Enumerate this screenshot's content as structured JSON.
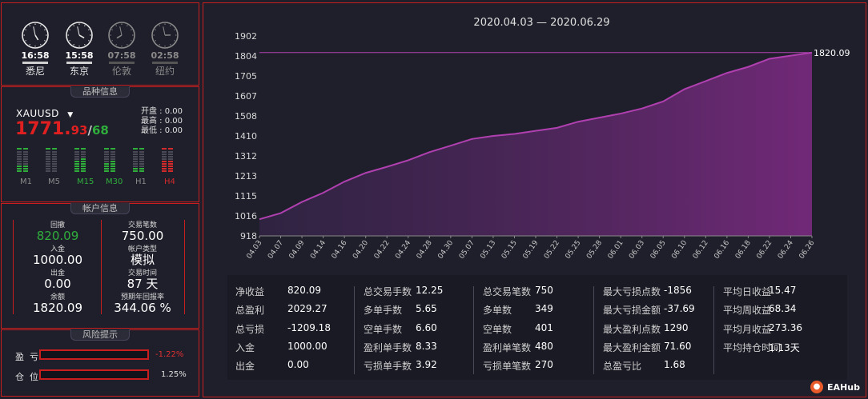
{
  "clocks": [
    {
      "time": "16:58",
      "city": "悉尼",
      "active": true,
      "h": 4,
      "m": 58
    },
    {
      "time": "15:58",
      "city": "东京",
      "active": true,
      "h": 3,
      "m": 58
    },
    {
      "time": "07:58",
      "city": "伦敦",
      "active": false,
      "h": 7,
      "m": 58
    },
    {
      "time": "02:58",
      "city": "纽约",
      "active": false,
      "h": 2,
      "m": 58
    }
  ],
  "symbol_panel": {
    "title": "品种信息",
    "symbol": "XAUUSD",
    "price_main": "1771.",
    "price_small": "93",
    "price_sep": "/",
    "price_ask": "68",
    "open": "开盘 : 0.00",
    "high": "最高 : 0.00",
    "low": "最低 : 0.00",
    "timeframes": [
      {
        "label": "M1",
        "color": "#8a8a8a"
      },
      {
        "label": "M5",
        "color": "#8a8a8a"
      },
      {
        "label": "M15",
        "color": "#2fae3c"
      },
      {
        "label": "M30",
        "color": "#2fae3c"
      },
      {
        "label": "H1",
        "color": "#8a8a8a"
      },
      {
        "label": "H4",
        "color": "#d22a2a"
      }
    ]
  },
  "account_panel": {
    "title": "帐户信息",
    "drawdown_label": "回撤",
    "drawdown_value": "820.09",
    "trades_label": "交易笔数",
    "trades_value": "750.00",
    "deposit_label": "入金",
    "deposit_value": "1000.00",
    "acct_type_label": "帐户类型",
    "acct_type_value": "模拟",
    "withdraw_label": "出金",
    "withdraw_value": "0.00",
    "trade_time_label": "交易时间",
    "trade_time_value": "87 天",
    "balance_label": "余额",
    "balance_value": "1820.09",
    "annual_label": "预期年回报率",
    "annual_value": "344.06 %"
  },
  "risk_panel": {
    "title": "风险提示",
    "pl_label": "盈  亏",
    "pl_value": "-1.22%",
    "pl_color": "#e03030",
    "pos_label": "仓  位",
    "pos_value": "1.25%"
  },
  "chart_data": {
    "type": "area",
    "title": "2020.04.03 — 2020.06.29",
    "x": [
      "04.03",
      "04.07",
      "04.09",
      "04.14",
      "04.16",
      "04.20",
      "04.22",
      "04.24",
      "04.28",
      "04.30",
      "05.07",
      "05.13",
      "05.15",
      "05.19",
      "05.22",
      "05.25",
      "05.28",
      "06.01",
      "06.03",
      "06.05",
      "06.10",
      "06.12",
      "06.16",
      "06.18",
      "06.22",
      "06.24",
      "06.26"
    ],
    "y": [
      1000,
      1030,
      1085,
      1130,
      1185,
      1228,
      1258,
      1290,
      1330,
      1362,
      1395,
      1410,
      1420,
      1435,
      1450,
      1480,
      1500,
      1520,
      1545,
      1580,
      1640,
      1680,
      1720,
      1750,
      1790,
      1805,
      1820.09
    ],
    "ylim": [
      918,
      1902
    ],
    "yticks": [
      1902,
      1804,
      1705,
      1607,
      1508,
      1410,
      1312,
      1213,
      1115,
      1016,
      918
    ],
    "last_label": "1820.09",
    "color": "#b040b0"
  },
  "stats": [
    {
      "k": "净收益",
      "v": "820.09"
    },
    {
      "k": "总盈利",
      "v": "2029.27"
    },
    {
      "k": "总亏损",
      "v": "-1209.18"
    },
    {
      "k": "入金",
      "v": "1000.00"
    },
    {
      "k": "出金",
      "v": "0.00"
    },
    {
      "k": "总交易手数",
      "v": "12.25"
    },
    {
      "k": "多单手数",
      "v": "5.65"
    },
    {
      "k": "空单手数",
      "v": "6.60"
    },
    {
      "k": "盈利单手数",
      "v": "8.33"
    },
    {
      "k": "亏损单手数",
      "v": "3.92"
    },
    {
      "k": "总交易笔数",
      "v": "750"
    },
    {
      "k": "多单数",
      "v": "349"
    },
    {
      "k": "空单数",
      "v": "401"
    },
    {
      "k": "盈利单笔数",
      "v": "480"
    },
    {
      "k": "亏损单笔数",
      "v": "270"
    },
    {
      "k": "最大亏损点数",
      "v": "-1856"
    },
    {
      "k": "最大亏损金额",
      "v": "-37.69"
    },
    {
      "k": "最大盈利点数",
      "v": "1290"
    },
    {
      "k": "最大盈利金额",
      "v": "71.60"
    },
    {
      "k": "总盈亏比",
      "v": "1.68"
    },
    {
      "k": "平均日收益",
      "v": "15.47"
    },
    {
      "k": "平均周收益",
      "v": "68.34"
    },
    {
      "k": "平均月收益",
      "v": "273.36"
    },
    {
      "k": "平均持仓时间",
      "v": "1.13天"
    }
  ],
  "watermark": "EAHub"
}
